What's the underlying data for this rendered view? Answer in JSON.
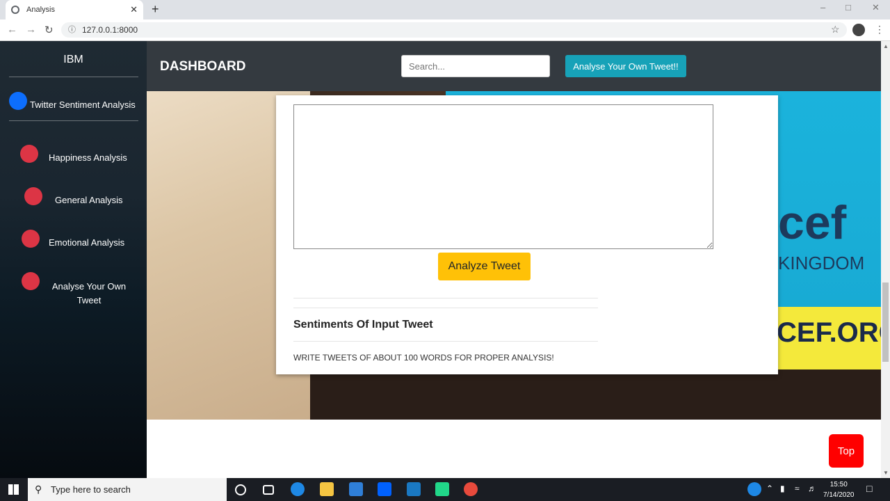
{
  "browser": {
    "tab_title": "Analysis",
    "tab_close": "✕",
    "new_tab": "+",
    "url": "127.0.0.1:8000"
  },
  "sidebar": {
    "brand": "IBM",
    "header_item": "Twitter Sentiment Analysis",
    "items": [
      {
        "label": "Happiness Analysis"
      },
      {
        "label": "General Analysis"
      },
      {
        "label": "Emotional Analysis"
      },
      {
        "label": "Analyse Your Own Tweet"
      }
    ]
  },
  "header": {
    "title": "DASHBOARD",
    "search_placeholder": "Search...",
    "own_tweet_button": "Analyse Your Own Tweet!!"
  },
  "card": {
    "analyze_button": "Analyze Tweet",
    "sentiments_title": "Sentiments Of Input Tweet",
    "hint": "WRITE TWEETS OF ABOUT 100 WORDS FOR PROPER ANALYSIS!"
  },
  "background_text": [
    "cef",
    "KINGDOM",
    "CEF.ORG."
  ],
  "top_button": "Top",
  "taskbar": {
    "search_placeholder": "Type here to search",
    "time": "15:50",
    "date": "7/14/2020"
  },
  "colors": {
    "dot_active": "#0d6efd",
    "dot_inactive": "#dc3545",
    "accent_teal": "#17a2b8",
    "analyze_yellow": "#ffc107",
    "top_red": "#ff0000"
  }
}
